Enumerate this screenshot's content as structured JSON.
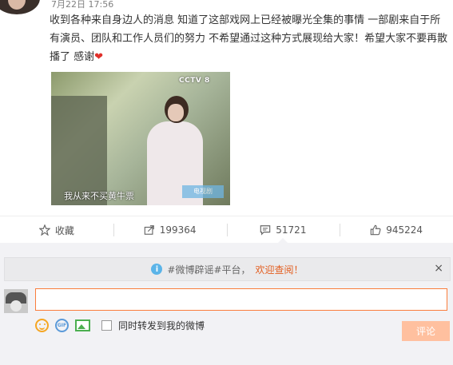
{
  "post": {
    "timestamp": "7月22日 17:56",
    "text": "收到各种来自身边人的消息 知道了这部戏网上已经被曝光全集的事情 一部剧来自于所有演员、团队和工作人员们的努力 不希望通过这种方式展现给大家！希望大家不要再散播了 感谢",
    "heart": "❤",
    "media": {
      "channel_logo": "CCTV 8",
      "subtitle": "我从来不买黄牛票",
      "watermark": "电视剧"
    }
  },
  "actions": {
    "favorite": {
      "label": "收藏",
      "icon": "star-icon"
    },
    "repost": {
      "count": "199364",
      "icon": "share-icon"
    },
    "comment": {
      "count": "51721",
      "icon": "comment-icon"
    },
    "like": {
      "count": "945224",
      "icon": "thumbs-up-icon"
    }
  },
  "notice": {
    "prefix": "#微博辟谣#平台，",
    "highlight": "欢迎查阅！",
    "close": "×"
  },
  "comment_box": {
    "placeholder": "",
    "repost_label": "同时转发到我的微博",
    "submit_label": "评论",
    "gif_label": "GIF"
  },
  "colors": {
    "accent": "#fa7d3c",
    "submit_disabled": "#ffc09f",
    "info": "#5bb4e8"
  }
}
